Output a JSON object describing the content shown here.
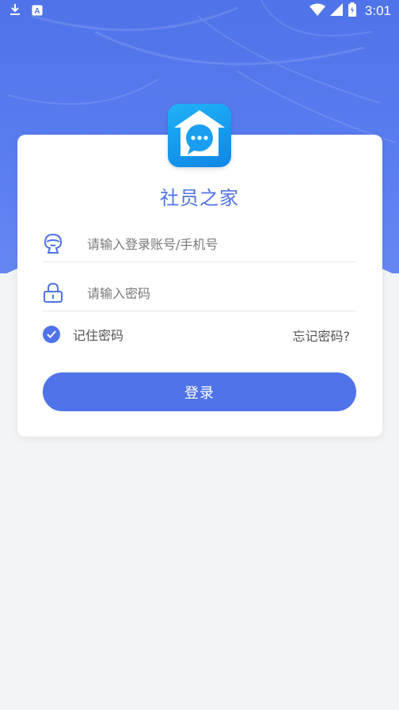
{
  "status_bar": {
    "time": "3:01",
    "icons": [
      "download-icon",
      "a-badge-icon",
      "wifi-icon",
      "signal-icon",
      "battery-icon"
    ]
  },
  "app": {
    "title": "社员之家",
    "logo": "chat-home-logo"
  },
  "login_form": {
    "account_placeholder": "请输入登录账号/手机号",
    "account_value": "",
    "password_placeholder": "请输入密码",
    "password_value": "",
    "remember_label": "记住密码",
    "remember_checked": true,
    "forgot_label": "忘记密码?",
    "login_label": "登录"
  },
  "colors": {
    "primary": "#4f73e8",
    "background": "#f3f4f6",
    "logo_gradient_start": "#1fb2f6",
    "logo_gradient_end": "#0f86e6"
  }
}
